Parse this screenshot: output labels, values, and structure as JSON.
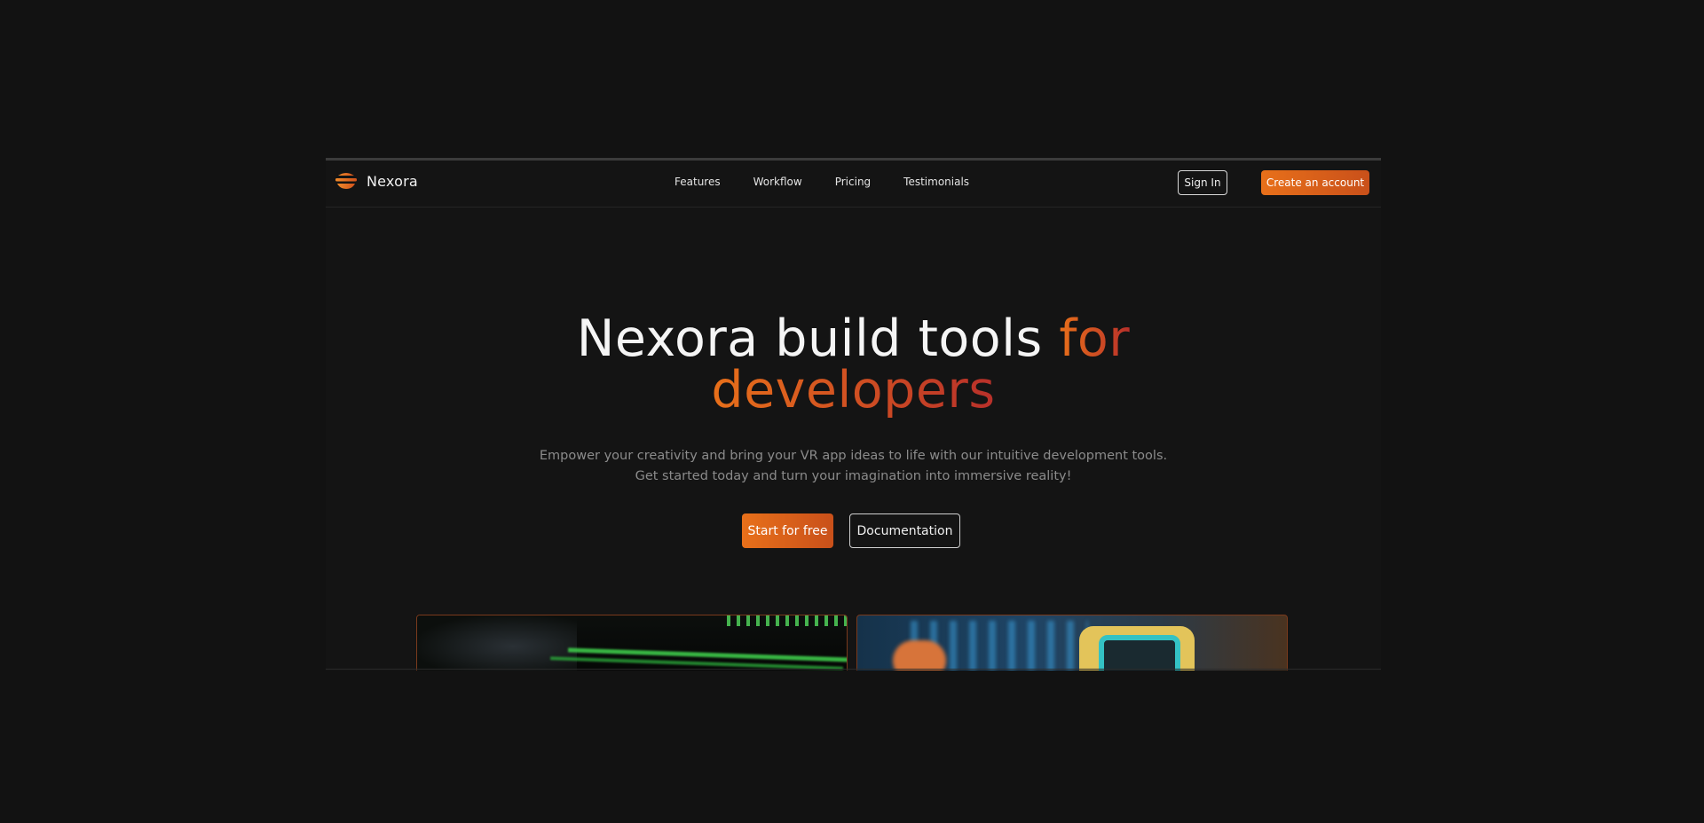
{
  "brand": {
    "name": "Nexora",
    "logo_icon": "stacked-layers-logo"
  },
  "nav": {
    "links": [
      "Features",
      "Workflow",
      "Pricing",
      "Testimonials"
    ],
    "sign_in": "Sign In",
    "create_account": "Create an account"
  },
  "hero": {
    "title_part1": "Nexora build tools ",
    "title_accent1": "for",
    "title_accent2": "developers",
    "subtitle_line1": "Empower your creativity and bring your VR app ideas to life with our intuitive development tools.",
    "subtitle_line2": "Get started today and turn your imagination into immersive reality!",
    "primary_cta": "Start for free",
    "secondary_cta": "Documentation"
  },
  "colors": {
    "background": "#121212",
    "accent_start": "#e8701a",
    "accent_end": "#b8302a"
  },
  "preview_cards": [
    {
      "subject": "code-terminal-image"
    },
    {
      "subject": "vr-headset-image"
    }
  ]
}
